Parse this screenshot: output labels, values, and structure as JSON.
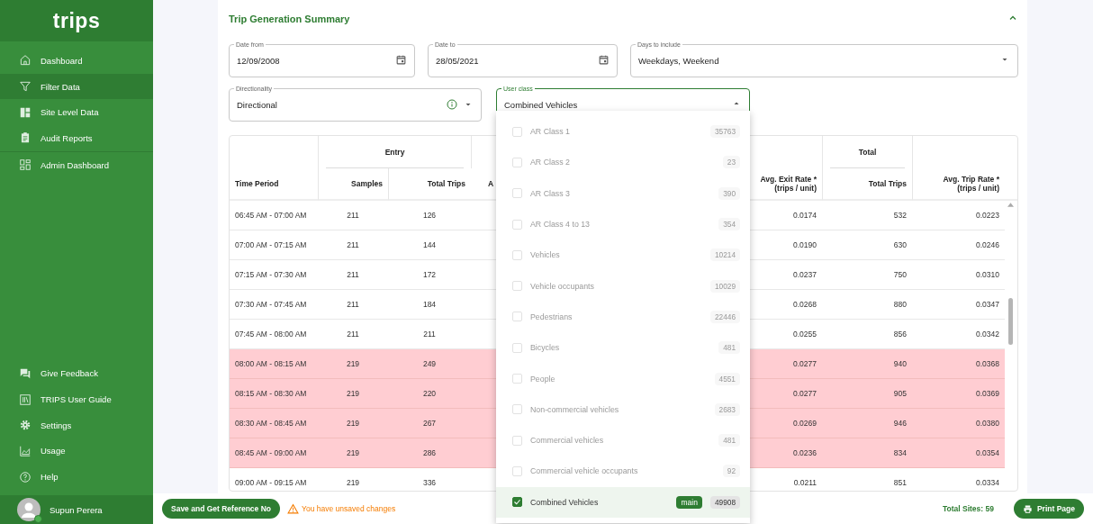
{
  "sidebar": {
    "logo": "trips",
    "items": [
      {
        "label": "Dashboard",
        "selected": false
      },
      {
        "label": "Filter Data",
        "selected": true
      },
      {
        "label": "Site Level Data",
        "selected": false
      },
      {
        "label": "Audit Reports",
        "selected": false
      }
    ],
    "admin_items": [
      {
        "label": "Admin Dashboard",
        "selected": false
      }
    ],
    "bottom_items": [
      {
        "label": "Give Feedback",
        "selected": false
      },
      {
        "label": "TRIPS User Guide",
        "selected": false
      },
      {
        "label": "Settings",
        "selected": false
      },
      {
        "label": "Usage",
        "selected": false
      },
      {
        "label": "Help",
        "selected": false
      }
    ],
    "user": {
      "name": "Supun Perera",
      "online": true
    }
  },
  "summary": {
    "title": "Trip Generation Summary",
    "expanded": true,
    "filters": [
      {
        "kind": "date",
        "label": "Date from",
        "value": "12/09/2008"
      },
      {
        "kind": "date",
        "label": "Date to",
        "value": "28/05/2021"
      },
      {
        "kind": "select",
        "label": "Days to include",
        "value": "Weekdays, Weekend"
      },
      {
        "kind": "select_info",
        "label": "Directionality",
        "value": "Directional"
      }
    ],
    "user_class": {
      "label": "User class",
      "value": "Combined Vehicles",
      "open": true,
      "options": [
        {
          "label": "AR Class 1",
          "count": "35763",
          "checked": false,
          "disabled": true
        },
        {
          "label": "AR Class 2",
          "count": "23",
          "checked": false,
          "disabled": true
        },
        {
          "label": "AR Class 3",
          "count": "390",
          "checked": false,
          "disabled": true
        },
        {
          "label": "AR Class 4 to 13",
          "count": "354",
          "checked": false,
          "disabled": true
        },
        {
          "label": "Vehicles",
          "count": "10214",
          "checked": false,
          "disabled": true
        },
        {
          "label": "Vehicle occupants",
          "count": "10029",
          "checked": false,
          "disabled": true
        },
        {
          "label": "Pedestrians",
          "count": "22446",
          "checked": false,
          "disabled": true
        },
        {
          "label": "Bicycles",
          "count": "481",
          "checked": false,
          "disabled": true
        },
        {
          "label": "People",
          "count": "4551",
          "checked": false,
          "disabled": true
        },
        {
          "label": "Non-commercial vehicles",
          "count": "2683",
          "checked": false,
          "disabled": true
        },
        {
          "label": "Commercial vehicles",
          "count": "481",
          "checked": false,
          "disabled": true
        },
        {
          "label": "Commercial vehicle occupants",
          "count": "92",
          "checked": false,
          "disabled": true
        },
        {
          "label": "Combined Vehicles",
          "count": "49908",
          "checked": true,
          "disabled": false,
          "tag": "main"
        }
      ]
    },
    "table": {
      "header_groups": [
        "Entry",
        "Total"
      ],
      "columns": [
        {
          "header": "Time Period"
        },
        {
          "header": "Samples"
        },
        {
          "header": "Total Trips"
        },
        {
          "header": "A"
        },
        {
          "header": "Avg. Exit Rate *",
          "subheader": "(trips / unit)"
        },
        {
          "header": "Total Trips"
        },
        {
          "header": "Avg. Trip Rate *",
          "subheader": "(trips / unit)"
        }
      ],
      "rows": [
        {
          "cells": [
            "06:45 AM - 07:00 AM",
            "211",
            "126",
            "",
            "0.0174",
            "532",
            "0.0223"
          ],
          "highlighted": false
        },
        {
          "cells": [
            "07:00 AM - 07:15 AM",
            "211",
            "144",
            "",
            "0.0190",
            "630",
            "0.0246"
          ],
          "highlighted": false
        },
        {
          "cells": [
            "07:15 AM - 07:30 AM",
            "211",
            "172",
            "",
            "0.0237",
            "750",
            "0.0310"
          ],
          "highlighted": false
        },
        {
          "cells": [
            "07:30 AM - 07:45 AM",
            "211",
            "184",
            "",
            "0.0268",
            "880",
            "0.0347"
          ],
          "highlighted": false
        },
        {
          "cells": [
            "07:45 AM - 08:00 AM",
            "211",
            "211",
            "",
            "0.0255",
            "856",
            "0.0342"
          ],
          "highlighted": false
        },
        {
          "cells": [
            "08:00 AM - 08:15 AM",
            "219",
            "249",
            "",
            "0.0277",
            "940",
            "0.0368"
          ],
          "highlighted": true
        },
        {
          "cells": [
            "08:15 AM - 08:30 AM",
            "219",
            "220",
            "",
            "0.0277",
            "905",
            "0.0369"
          ],
          "highlighted": true
        },
        {
          "cells": [
            "08:30 AM - 08:45 AM",
            "219",
            "267",
            "",
            "0.0269",
            "946",
            "0.0380"
          ],
          "highlighted": true
        },
        {
          "cells": [
            "08:45 AM - 09:00 AM",
            "219",
            "286",
            "",
            "0.0236",
            "834",
            "0.0354"
          ],
          "highlighted": true
        },
        {
          "cells": [
            "09:00 AM - 09:15 AM",
            "219",
            "336",
            "",
            "0.0211",
            "851",
            "0.0334"
          ],
          "highlighted": false
        }
      ]
    }
  },
  "footer": {
    "save_button": "Save and Get Reference No",
    "warning": "You have unsaved changes",
    "total_sites": "Total Sites: 59",
    "print_button": "Print Page"
  }
}
